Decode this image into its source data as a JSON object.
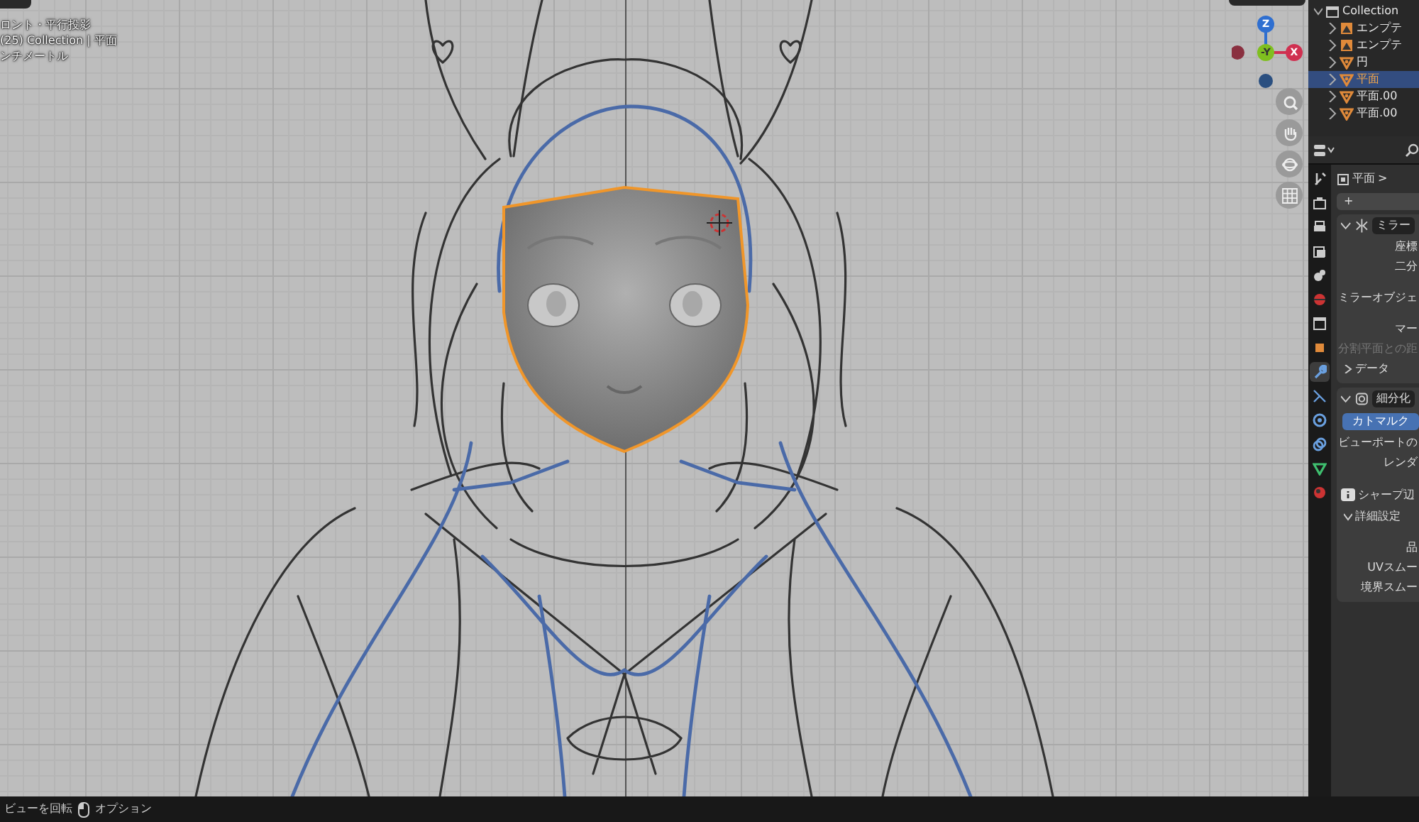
{
  "viewport": {
    "info": [
      "ロント・平行投影",
      "(25) Collection | 平面",
      "ンチメートル"
    ],
    "gizmo_axes": [
      {
        "label": "Z",
        "kind": "pos"
      },
      {
        "label": "-Y",
        "kind": "neg"
      },
      {
        "label": "X",
        "kind": "pos"
      }
    ],
    "nav_buttons": [
      {
        "kind": "zoom"
      },
      {
        "kind": "hand"
      },
      {
        "kind": "orbit"
      },
      {
        "kind": "grid"
      }
    ]
  },
  "outliner": {
    "items": [
      {
        "label": "Collection",
        "kind": "collection",
        "selected": false,
        "children": [
          {
            "label": "エンプテ",
            "kind": "empty",
            "selected": false
          },
          {
            "label": "エンプテ",
            "kind": "empty",
            "selected": false
          },
          {
            "label": "円",
            "kind": "mesh",
            "selected": false
          },
          {
            "label": "平面",
            "kind": "mesh",
            "selected": true
          },
          {
            "label": "平面.00",
            "kind": "mesh",
            "selected": false
          },
          {
            "label": "平面.00",
            "kind": "mesh",
            "selected": false
          }
        ]
      }
    ]
  },
  "properties": {
    "breadcrumb": [
      "平面",
      ">"
    ],
    "tabs": [
      {
        "kind": "tool",
        "selected": false
      },
      {
        "kind": "render",
        "selected": false
      },
      {
        "kind": "output",
        "selected": false
      },
      {
        "kind": "view",
        "selected": false
      },
      {
        "kind": "scene",
        "selected": false
      },
      {
        "kind": "world",
        "selected": false
      },
      {
        "kind": "collection",
        "selected": false
      },
      {
        "kind": "object",
        "selected": false
      },
      {
        "kind": "modifier",
        "selected": true
      },
      {
        "kind": "particles",
        "selected": false
      },
      {
        "kind": "physics",
        "selected": false
      },
      {
        "kind": "constraint",
        "selected": false
      },
      {
        "kind": "data",
        "selected": false
      },
      {
        "kind": "material",
        "selected": false
      }
    ],
    "add_button": "+",
    "modifiers": [
      {
        "name": "ミラー",
        "expanded": true,
        "rows": [
          {
            "kind": "label",
            "text": "座標",
            "disabled": false
          },
          {
            "kind": "label",
            "text": "二分",
            "disabled": false
          },
          {
            "kind": "spacer"
          },
          {
            "kind": "label",
            "text": "ミラーオブジェ",
            "disabled": false
          },
          {
            "kind": "spacer"
          },
          {
            "kind": "label",
            "text": "マー",
            "disabled": false
          },
          {
            "kind": "label",
            "text": "分割平面との距",
            "disabled": true
          },
          {
            "kind": "subpanel",
            "text": "データ",
            "expanded": false
          }
        ]
      },
      {
        "name": "細分化",
        "expanded": true,
        "rows": [
          {
            "kind": "toggle",
            "text": "カトマルク",
            "selected": true
          },
          {
            "kind": "label",
            "text": "ビューポートの",
            "disabled": false
          },
          {
            "kind": "label",
            "text": "レンダ",
            "disabled": false
          },
          {
            "kind": "spacer"
          },
          {
            "kind": "info",
            "text": "シャープ辺"
          },
          {
            "kind": "subpanel",
            "text": "詳細設定",
            "expanded": true
          },
          {
            "kind": "spacer"
          },
          {
            "kind": "label",
            "text": "品",
            "disabled": false
          },
          {
            "kind": "label",
            "text": "UVスムー",
            "disabled": false
          },
          {
            "kind": "label",
            "text": "境界スムー",
            "disabled": false
          }
        ]
      }
    ]
  },
  "status_bar": [
    {
      "kind": "text",
      "text": "ビューを回転"
    },
    {
      "kind": "mouse",
      "text": "オプション"
    }
  ]
}
